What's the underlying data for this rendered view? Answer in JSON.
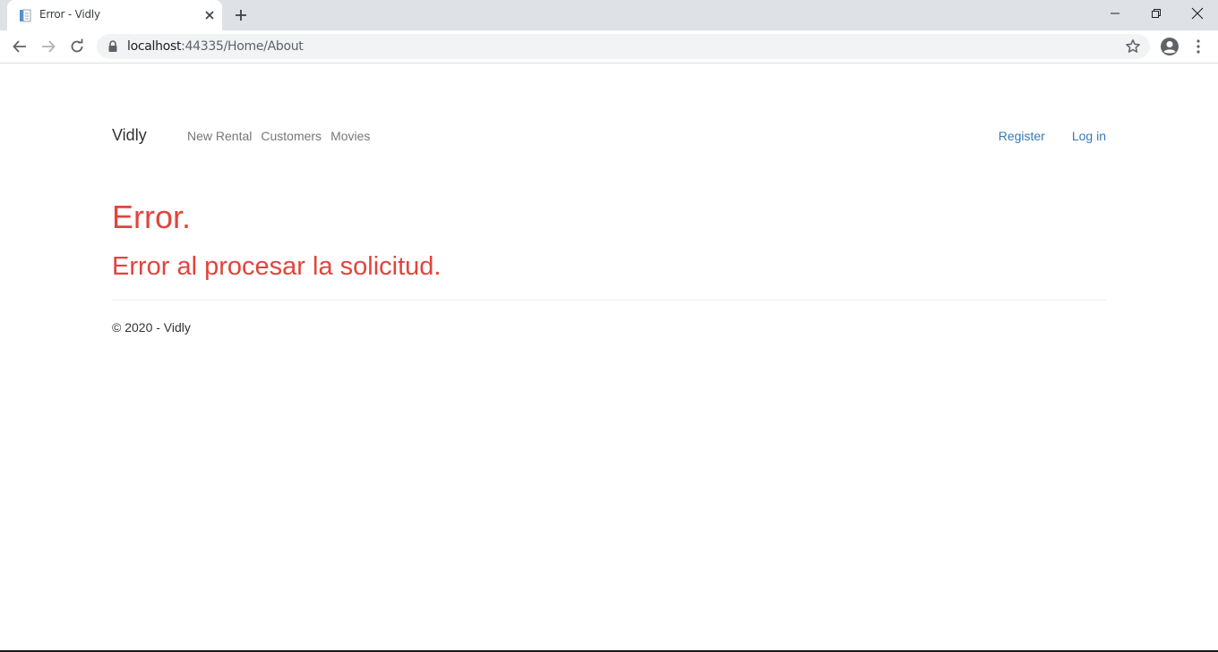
{
  "browser": {
    "tab_title": "Error - Vidly",
    "url_host": "localhost",
    "url_rest": ":44335/Home/About"
  },
  "navbar": {
    "brand": "Vidly",
    "links": [
      "New Rental",
      "Customers",
      "Movies"
    ],
    "register": "Register",
    "login": "Log in"
  },
  "content": {
    "title": "Error.",
    "message": "Error al procesar la solicitud."
  },
  "footer": {
    "text": "© 2020 - Vidly"
  },
  "colors": {
    "error": "#e0453c",
    "link": "#337ab7",
    "muted_link": "#777777"
  }
}
